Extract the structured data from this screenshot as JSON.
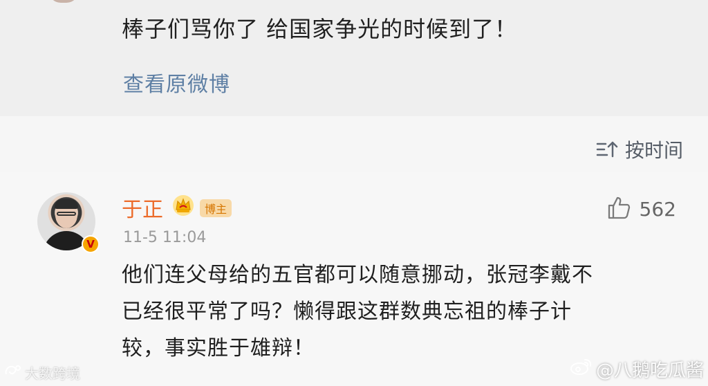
{
  "repost": {
    "text": "棒子们骂你了 给国家争光的时候到了！",
    "view_original_label": "查看原微博"
  },
  "sort": {
    "label": "按时间",
    "icon": "sort-icon"
  },
  "comment": {
    "username": "于正",
    "badge_label": "博主",
    "timestamp": "11-5 11:04",
    "likes": "562",
    "text_lines": [
      "他们连父母给的五官都可以随意挪动，张冠李戴不",
      "已经很平常了吗？懒得跟这群数典忘祖的棒子计",
      "较，事实胜于雄辩！"
    ],
    "verified_badge": "V"
  },
  "watermarks": {
    "left": "大数跨境",
    "right": "@八鹅吃瓜酱"
  },
  "colors": {
    "username": "#ec6b2a",
    "link": "#5e7fa4",
    "badge_bg": "#f8d9a8",
    "badge_text": "#d57500",
    "verified": "#f6a400"
  }
}
